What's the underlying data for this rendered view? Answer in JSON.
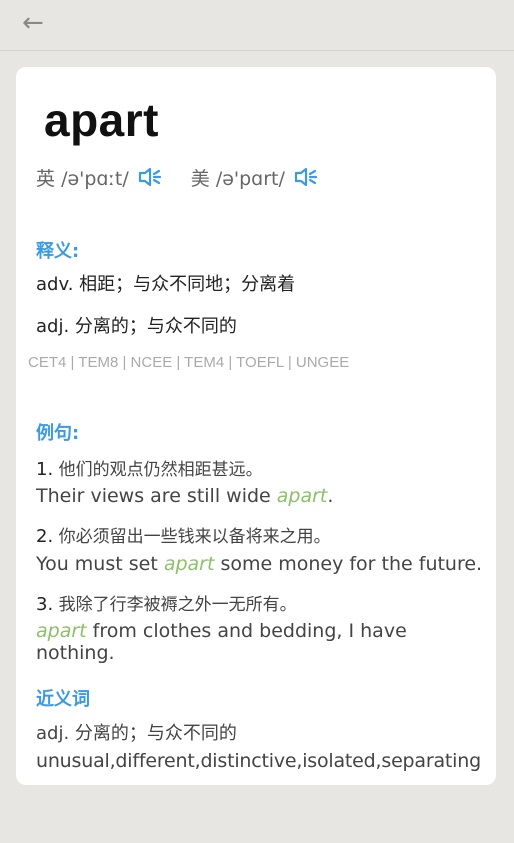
{
  "header": {
    "back_icon": "←"
  },
  "word": {
    "headword": "apart",
    "uk_label": "英",
    "uk_phonetic": "/ə'pɑːt/",
    "us_label": "美",
    "us_phonetic": "/ə'pɑrt/"
  },
  "definitions": {
    "title": "释义:",
    "items": [
      {
        "pos": "adv.",
        "text": "相距；与众不同地；分离着"
      },
      {
        "pos": "adj.",
        "text": "分离的；与众不同的"
      }
    ],
    "tags": "CET4 | TEM8 | NCEE | TEM4 | TOEFL | UNGEE"
  },
  "examples": {
    "title": "例句:",
    "items": [
      {
        "num": "1.",
        "cn": "他们的观点仍然相距甚远。",
        "en_before": "Their views are still wide ",
        "en_hl": "apart",
        "en_after": "."
      },
      {
        "num": "2.",
        "cn": "你必须留出一些钱来以备将来之用。",
        "en_before": "You must set ",
        "en_hl": "apart",
        "en_after": " some money for the future."
      },
      {
        "num": "3.",
        "cn": "我除了行李被褥之外一无所有。",
        "en_before": "",
        "en_hl": "apart",
        "en_after": " from clothes and bedding, I have nothing."
      }
    ]
  },
  "synonyms": {
    "title": "近义词",
    "pos": "adj.",
    "meaning": "分离的；与众不同的",
    "list": "unusual,different,distinctive,isolated,separating"
  },
  "colors": {
    "accent": "#3a9be0",
    "highlight": "#8cc06b",
    "background": "#e8e6e2"
  },
  "icons": {
    "speaker": "speaker-icon",
    "back": "back-arrow-icon"
  }
}
